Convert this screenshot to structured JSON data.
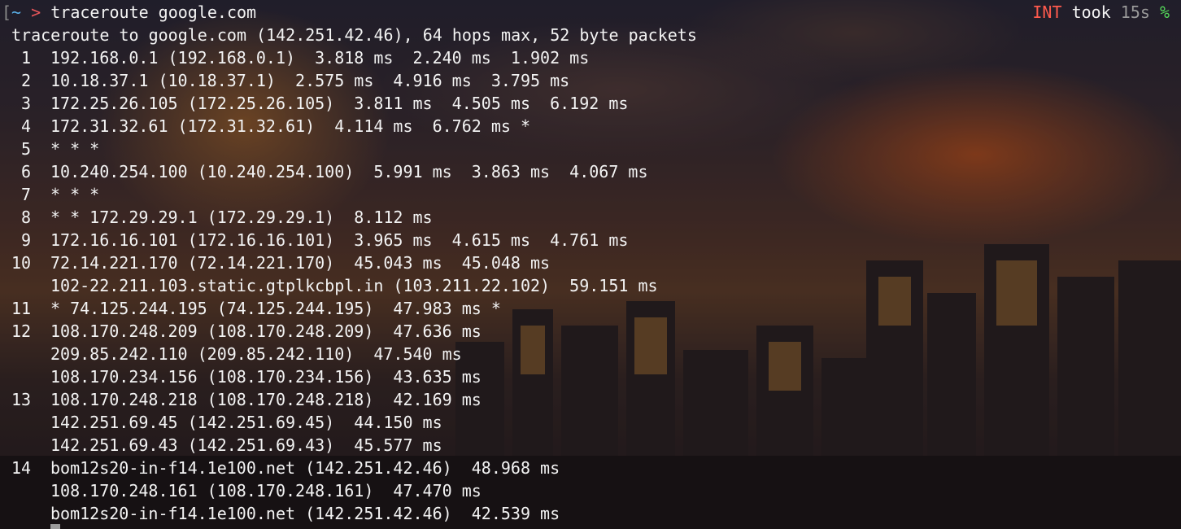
{
  "prompt": {
    "open_bracket": "[",
    "dir": "~",
    "arrow": ">",
    "command": "traceroute google.com"
  },
  "status": {
    "signal": "INT",
    "took_label": "took",
    "duration": "15s",
    "symbol": "%"
  },
  "header_line": "traceroute to google.com (142.251.42.46), 64 hops max, 52 byte packets",
  "hops": [
    {
      "hop": "1",
      "text": "192.168.0.1 (192.168.0.1)  3.818 ms  2.240 ms  1.902 ms"
    },
    {
      "hop": "2",
      "text": "10.18.37.1 (10.18.37.1)  2.575 ms  4.916 ms  3.795 ms"
    },
    {
      "hop": "3",
      "text": "172.25.26.105 (172.25.26.105)  3.811 ms  4.505 ms  6.192 ms"
    },
    {
      "hop": "4",
      "text": "172.31.32.61 (172.31.32.61)  4.114 ms  6.762 ms *"
    },
    {
      "hop": "5",
      "text": "* * *"
    },
    {
      "hop": "6",
      "text": "10.240.254.100 (10.240.254.100)  5.991 ms  3.863 ms  4.067 ms"
    },
    {
      "hop": "7",
      "text": "* * *"
    },
    {
      "hop": "8",
      "text": "* * 172.29.29.1 (172.29.29.1)  8.112 ms"
    },
    {
      "hop": "9",
      "text": "172.16.16.101 (172.16.16.101)  3.965 ms  4.615 ms  4.761 ms"
    },
    {
      "hop": "10",
      "text": "72.14.221.170 (72.14.221.170)  45.043 ms  45.048 ms"
    },
    {
      "hop": "",
      "text": "102-22.211.103.static.gtplkcbpl.in (103.211.22.102)  59.151 ms"
    },
    {
      "hop": "11",
      "text": "* 74.125.244.195 (74.125.244.195)  47.983 ms *"
    },
    {
      "hop": "12",
      "text": "108.170.248.209 (108.170.248.209)  47.636 ms"
    },
    {
      "hop": "",
      "text": "209.85.242.110 (209.85.242.110)  47.540 ms"
    },
    {
      "hop": "",
      "text": "108.170.234.156 (108.170.234.156)  43.635 ms"
    },
    {
      "hop": "13",
      "text": "108.170.248.218 (108.170.248.218)  42.169 ms"
    },
    {
      "hop": "",
      "text": "142.251.69.45 (142.251.69.45)  44.150 ms"
    },
    {
      "hop": "",
      "text": "142.251.69.43 (142.251.69.43)  45.577 ms"
    },
    {
      "hop": "14",
      "text": "bom12s20-in-f14.1e100.net (142.251.42.46)  48.968 ms"
    },
    {
      "hop": "",
      "text": "108.170.248.161 (108.170.248.161)  47.470 ms"
    },
    {
      "hop": "",
      "text": "bom12s20-in-f14.1e100.net (142.251.42.46)  42.539 ms"
    }
  ],
  "colors": {
    "text": "#f3f3f3",
    "dir": "#5ab0e8",
    "arrow": "#e8565a",
    "int": "#ff5a4d",
    "percent": "#55d85a"
  }
}
